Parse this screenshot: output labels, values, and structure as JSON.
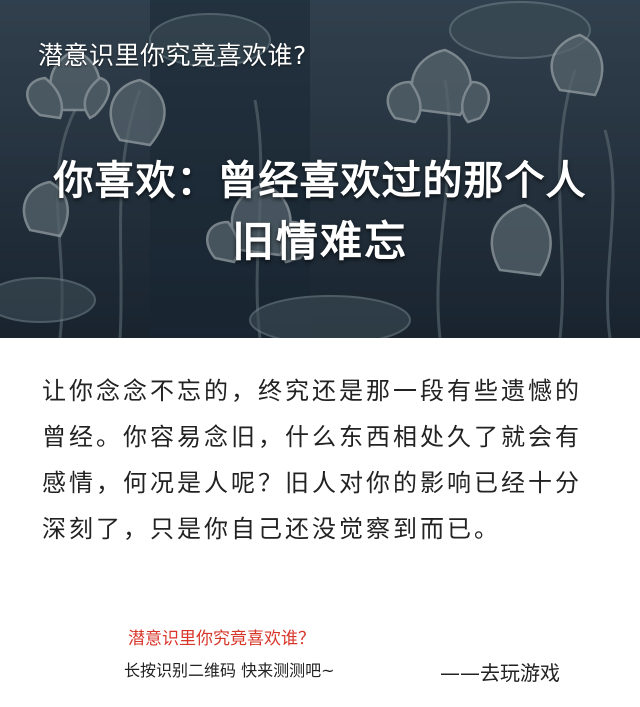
{
  "hero": {
    "kicker": "潜意识里你究竟喜欢谁?",
    "headline": "你喜欢：曾经喜欢过的那个人",
    "subhead": "旧情难忘"
  },
  "article": {
    "paragraph": "让你念念不忘的，终究还是那一段有些遗憾的曾经。你容易念旧，什么东西相处久了就会有感情，何况是人呢？旧人对你的影响已经十分深刻了，只是你自己还没觉察到而已。"
  },
  "footer": {
    "question": "潜意识里你究竟喜欢谁？",
    "cta": "长按识别二维码  快来测测吧~",
    "signature": "——去玩游戏"
  },
  "colors": {
    "accent_red": "#d9362a",
    "hero_dark": "#1f2d3a"
  }
}
